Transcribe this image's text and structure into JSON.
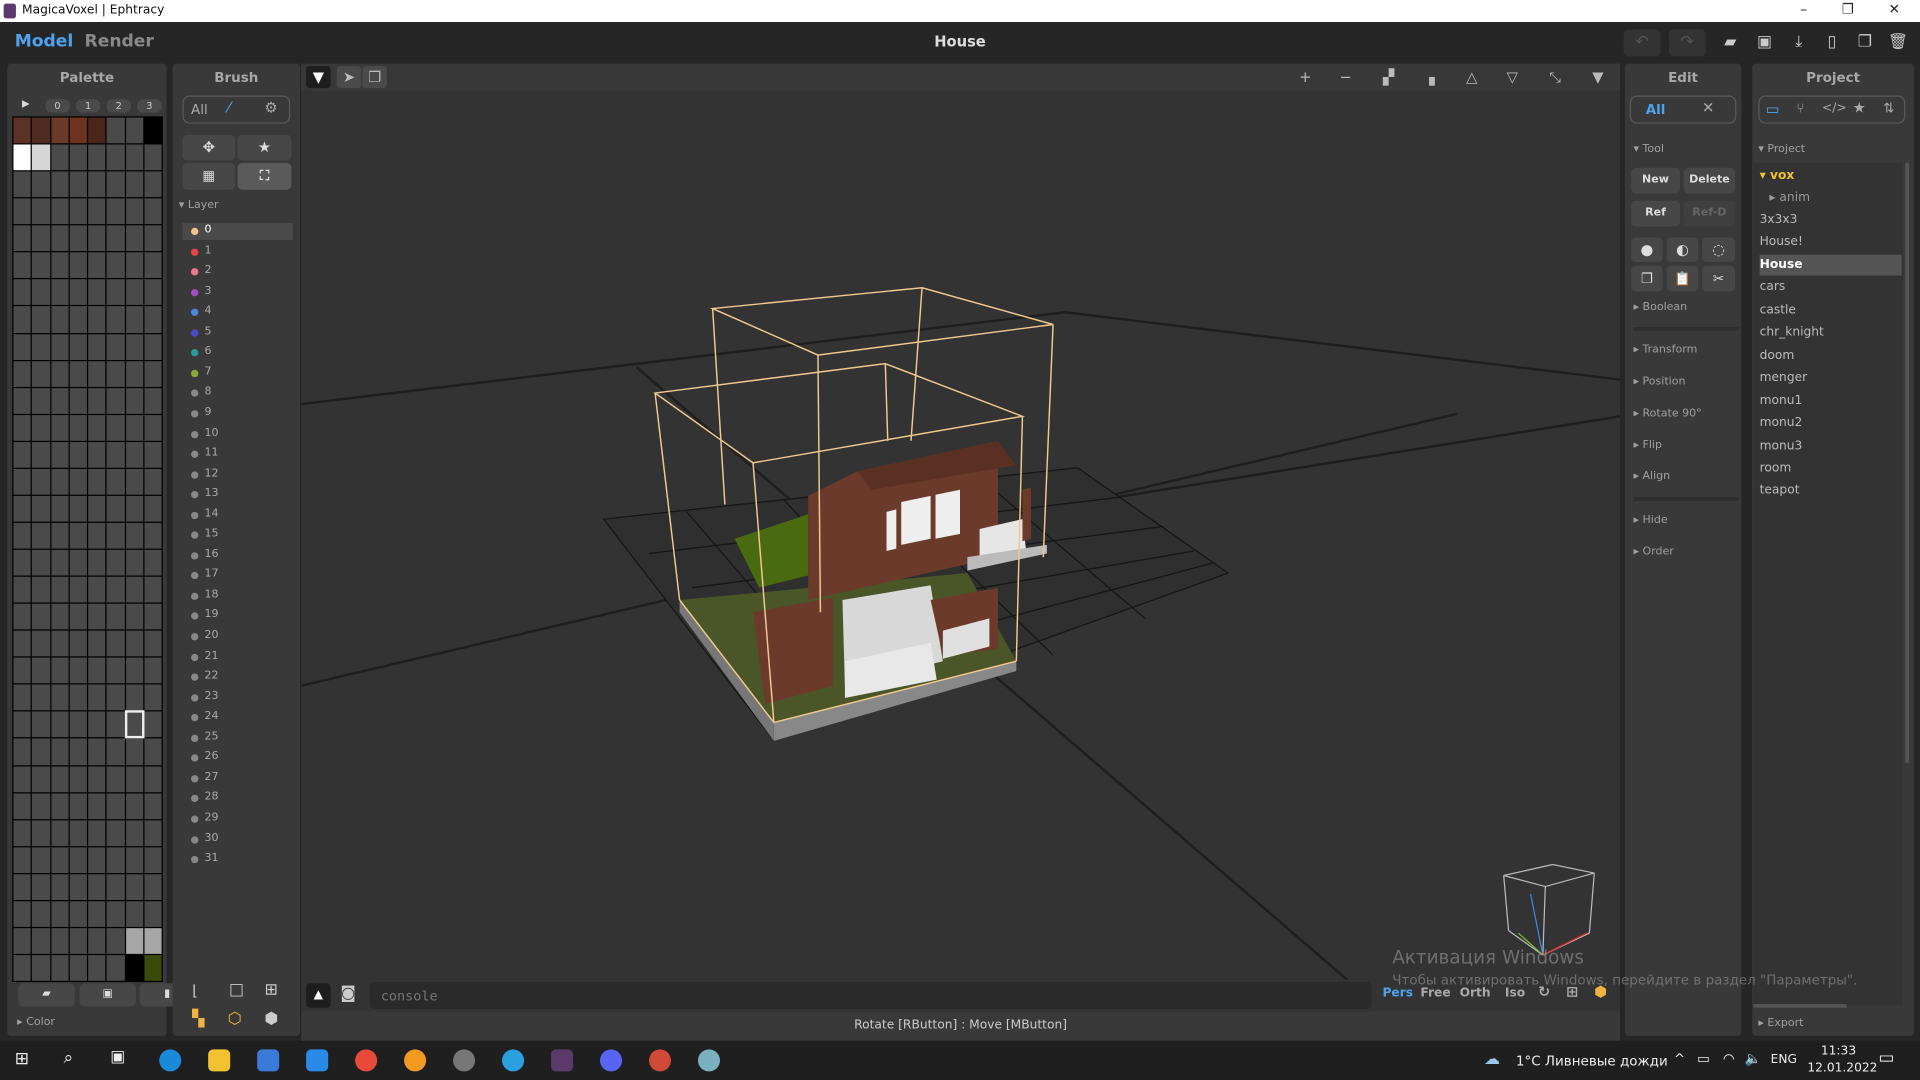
{
  "window": {
    "title": "MagicaVoxel | Ephtracy",
    "minimize": "–",
    "restore": "❐",
    "close": "✕"
  },
  "app": {
    "modes": [
      "Model",
      "Render"
    ],
    "active_mode": "Model",
    "document_title": "House",
    "accent": "#4ea3ee",
    "top_icons": [
      "undo-icon",
      "redo-icon",
      "open-folder-icon",
      "save-icon",
      "export-icon",
      "new-file-icon",
      "duplicate-icon",
      "delete-icon"
    ]
  },
  "palette": {
    "title": "Palette",
    "play": "▶",
    "tabs": [
      "0",
      "1",
      "2",
      "3"
    ],
    "default_color": "#4a4a4a",
    "cells": {
      "0": "#5a3326",
      "1": "#4f2a1f",
      "2": "#6b3a28",
      "3": "#6e3320",
      "4": "#4a2519",
      "7": "#000000",
      "8": "#ffffff",
      "9": "#d6d6d6",
      "246": "#a6a6a6",
      "247": "#a6a6a6",
      "254": "#000000",
      "255": "#3a4a08"
    },
    "selected_index": 182,
    "buttons": [
      "open-folder-icon",
      "save-icon",
      "new-file-icon"
    ],
    "color_section": "Color"
  },
  "brush": {
    "title": "Brush",
    "mode_all": "All",
    "layer_header": "Layer",
    "layers": [
      {
        "n": "0",
        "c": "#f5c18a"
      },
      {
        "n": "1",
        "c": "#e84545"
      },
      {
        "n": "2",
        "c": "#e87a8c"
      },
      {
        "n": "3",
        "c": "#a44cc0"
      },
      {
        "n": "4",
        "c": "#4a88d8"
      },
      {
        "n": "5",
        "c": "#4a4ac8"
      },
      {
        "n": "6",
        "c": "#2a9a9a"
      },
      {
        "n": "7",
        "c": "#8aaa3a"
      },
      {
        "n": "8",
        "c": "#888888"
      },
      {
        "n": "9",
        "c": "#888888"
      },
      {
        "n": "10",
        "c": "#888888"
      },
      {
        "n": "11",
        "c": "#888888"
      },
      {
        "n": "12",
        "c": "#888888"
      },
      {
        "n": "13",
        "c": "#888888"
      },
      {
        "n": "14",
        "c": "#888888"
      },
      {
        "n": "15",
        "c": "#888888"
      },
      {
        "n": "16",
        "c": "#888888"
      },
      {
        "n": "17",
        "c": "#888888"
      },
      {
        "n": "18",
        "c": "#888888"
      },
      {
        "n": "19",
        "c": "#888888"
      },
      {
        "n": "20",
        "c": "#888888"
      },
      {
        "n": "21",
        "c": "#888888"
      },
      {
        "n": "22",
        "c": "#888888"
      },
      {
        "n": "23",
        "c": "#888888"
      },
      {
        "n": "24",
        "c": "#888888"
      },
      {
        "n": "25",
        "c": "#888888"
      },
      {
        "n": "26",
        "c": "#888888"
      },
      {
        "n": "27",
        "c": "#888888"
      },
      {
        "n": "28",
        "c": "#888888"
      },
      {
        "n": "29",
        "c": "#888888"
      },
      {
        "n": "30",
        "c": "#888888"
      },
      {
        "n": "31",
        "c": "#888888"
      }
    ],
    "selected_layer": "0"
  },
  "viewport": {
    "console_placeholder": "console",
    "view_modes": [
      "Pers",
      "Free",
      "Orth",
      "Iso"
    ],
    "active_view": "Pers",
    "status": "Rotate [RButton] : Move [MButton]"
  },
  "edit": {
    "title": "Edit",
    "mode_all": "All",
    "tool_header": "Tool",
    "new": "New",
    "delete": "Delete",
    "ref": "Ref",
    "refd": "Ref-D",
    "sections": [
      "Boolean",
      "Transform",
      "Position",
      "Rotate 90°",
      "Flip",
      "Align",
      "Hide",
      "Order"
    ]
  },
  "project": {
    "title": "Project",
    "section": "Project",
    "folder": "vox",
    "subfolder": "anim",
    "files": [
      "3x3x3",
      "House!",
      "House",
      "cars",
      "castle",
      "chr_knight",
      "doom",
      "menger",
      "monu1",
      "monu2",
      "monu3",
      "room",
      "teapot"
    ],
    "selected": "House",
    "export": "Export",
    "folder_color": "#f2c230"
  },
  "watermark": {
    "title": "Активация Windows",
    "text": "Чтобы активировать Windows, перейдите в раздел \"Параметры\"."
  },
  "taskbar": {
    "weather": "1°C  Ливневые дожди",
    "lang": "ENG",
    "time": "11:33",
    "date": "12.01.2022"
  }
}
